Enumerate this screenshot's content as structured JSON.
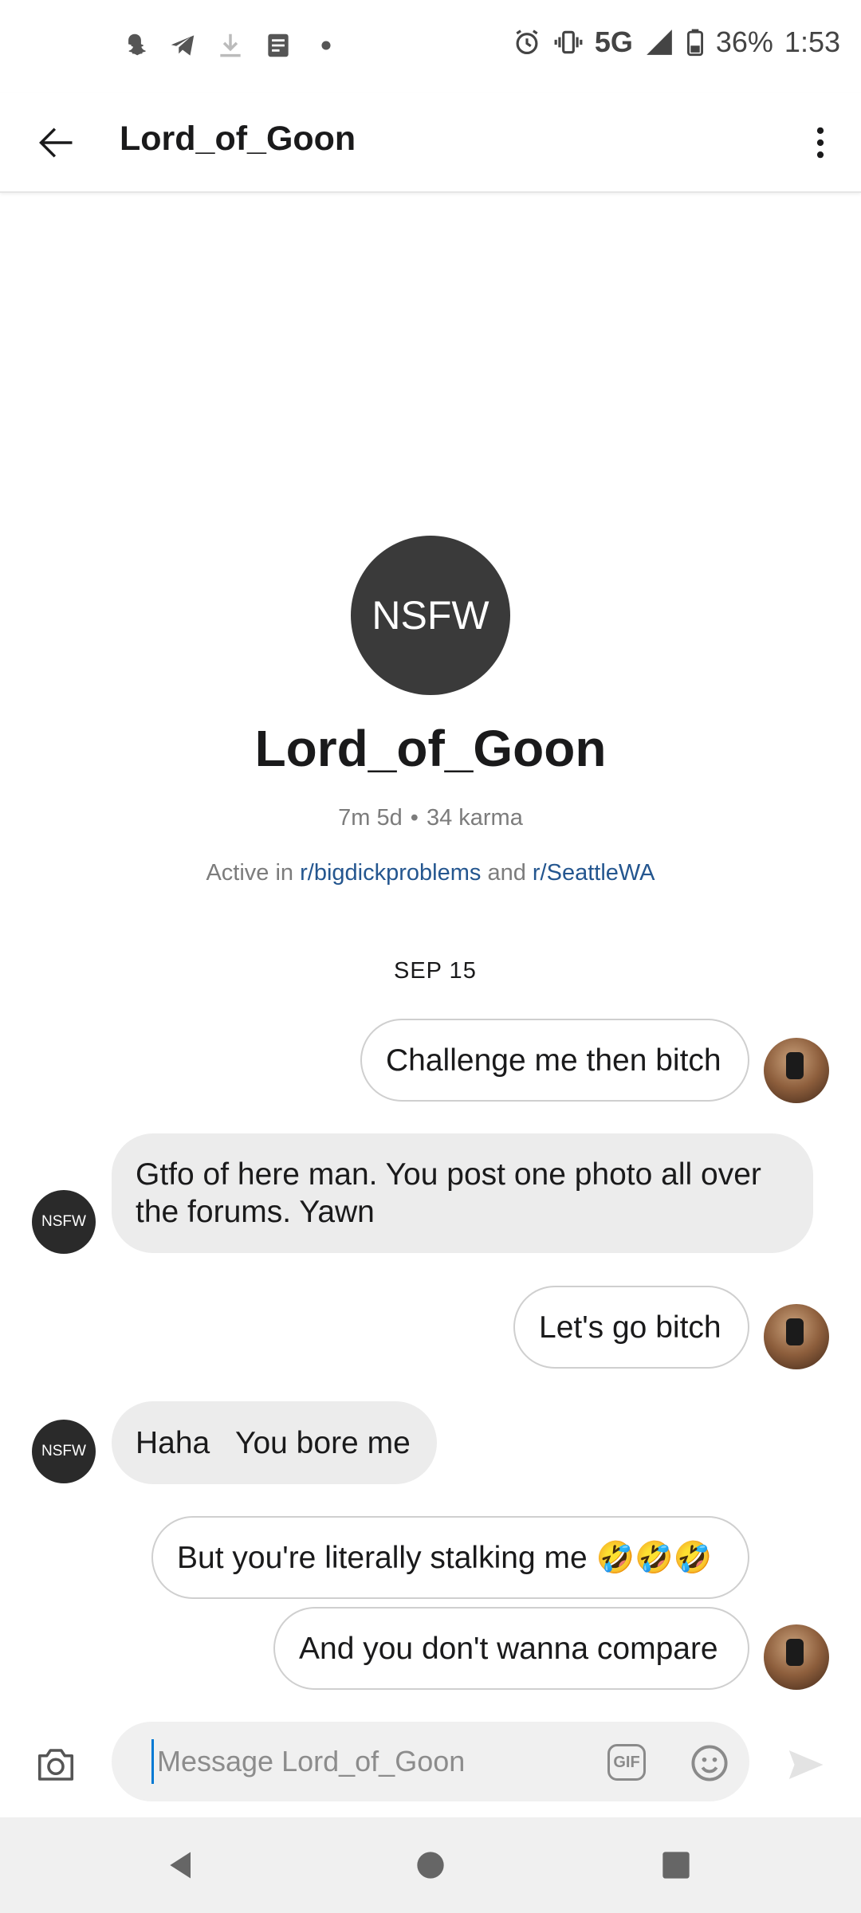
{
  "status_bar": {
    "network": "5G",
    "battery": "36%",
    "time": "1:53"
  },
  "header": {
    "title": "Lord_of_Goon"
  },
  "profile": {
    "avatar_text": "NSFW",
    "name": "Lord_of_Goon",
    "age": "7m 5d",
    "separator": "•",
    "karma": "34 karma",
    "active_prefix": "Active in ",
    "sub1": "r/bigdickproblems",
    "active_and": " and ",
    "sub2": "r/SeattleWA"
  },
  "chat": {
    "date": "SEP 15",
    "other_avatar_text": "NSFW",
    "messages": [
      {
        "from": "me",
        "text": "Challenge me then bitch"
      },
      {
        "from": "them",
        "text": "Gtfo of here man.  You post one photo all over the forums.  Yawn"
      },
      {
        "from": "me",
        "text": "Let's go bitch"
      },
      {
        "from": "them",
        "text": "Haha   You bore me"
      },
      {
        "from": "me",
        "text": "But you're literally stalking me 🤣🤣🤣"
      },
      {
        "from": "me",
        "text": "And you don't wanna compare"
      }
    ]
  },
  "composer": {
    "placeholder": "Message Lord_of_Goon",
    "gif_label": "GIF"
  },
  "colors": {
    "link": "#24568f",
    "avatar_dark": "#3a3a3a",
    "theirs_bubble": "#ececec",
    "cursor": "#0079d3"
  }
}
